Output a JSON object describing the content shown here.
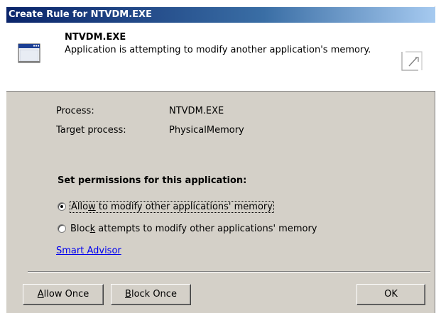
{
  "window": {
    "title": "Create Rule for NTVDM.EXE"
  },
  "header": {
    "app_icon": "application-window-icon",
    "app_name": "NTVDM.EXE",
    "description": "Application is attempting to modify another application's memory.",
    "corner_icon": "memory-chip-icon"
  },
  "info": {
    "process_label": "Process:",
    "process_value": "NTVDM.EXE",
    "target_label": "Target process:",
    "target_value": "PhysicalMemory"
  },
  "permissions": {
    "title": "Set permissions for this application:",
    "options": [
      {
        "pre": "Allo",
        "key": "w",
        "post": " to modify other applications' memory",
        "checked": true
      },
      {
        "pre": "Bloc",
        "key": "k",
        "post": " attempts to modify other applications' memory",
        "checked": false
      }
    ]
  },
  "smart_advisor": "Smart Advisor",
  "buttons": {
    "allow_once": {
      "pre": "",
      "key": "A",
      "post": "llow Once"
    },
    "block_once": {
      "pre": "",
      "key": "B",
      "post": "lock Once"
    },
    "ok": "OK"
  }
}
